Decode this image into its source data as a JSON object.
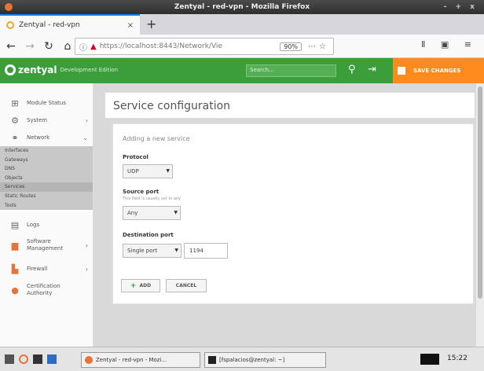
{
  "window": {
    "title": "Zentyal - red-vpn - Mozilla Firefox",
    "controls": "- + x"
  },
  "browser": {
    "tab_label": "Zentyal - red-vpn",
    "url": "https://localhost:8443/Network/Vie",
    "zoom": "90%",
    "nav_right_icons": "Ⅱ ▣ ≡"
  },
  "zentyal": {
    "logo": "zentyal",
    "edition": "Development Edition",
    "search_placeholder": "Search...",
    "save_label": "SAVE CHANGES"
  },
  "sidebar": {
    "items": [
      {
        "label": "Module Status",
        "icon": "grid-icon"
      },
      {
        "label": "System",
        "icon": "gear-icon"
      },
      {
        "label": "Network",
        "icon": "network-icon"
      }
    ],
    "network_sub": [
      "Interfaces",
      "Gateways",
      "DNS",
      "Objects",
      "Services",
      "Static Routes",
      "Tools"
    ],
    "bottom_items": [
      {
        "label": "Logs",
        "icon": "logs-icon"
      },
      {
        "label": "Software Management",
        "icon": "package-icon"
      },
      {
        "label": "Firewall",
        "icon": "firewall-icon"
      },
      {
        "label": "Certification Authority",
        "icon": "certificate-icon"
      }
    ]
  },
  "main": {
    "title": "Service configuration",
    "subtitle": "Adding a new service",
    "protocol_label": "Protocol",
    "protocol_value": "UDP",
    "source_label": "Source port",
    "source_hint": "This field is usually set to any",
    "source_value": "Any",
    "dest_label": "Destination port",
    "dest_type": "Single port",
    "dest_port": "1194",
    "add_label": "ADD",
    "cancel_label": "CANCEL"
  },
  "taskbar": {
    "task1": "Zentyal - red-vpn - Mozi...",
    "task2": "[fspalacios@zentyal: ~]",
    "clock": "15:22"
  }
}
